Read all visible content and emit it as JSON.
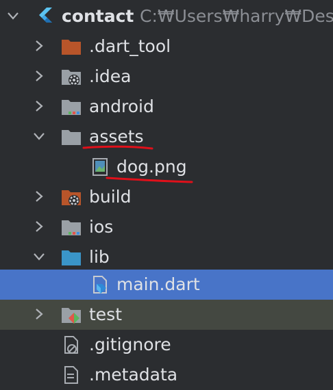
{
  "project": {
    "name": "contact",
    "path": "C:₩Users₩harry₩Desl"
  },
  "tree": {
    "items": [
      {
        "label": ".dart_tool"
      },
      {
        "label": ".idea"
      },
      {
        "label": "android"
      },
      {
        "label": "assets"
      },
      {
        "label": "dog.png"
      },
      {
        "label": "build"
      },
      {
        "label": "ios"
      },
      {
        "label": "lib"
      },
      {
        "label": "main.dart"
      },
      {
        "label": "test"
      },
      {
        "label": ".gitignore"
      },
      {
        "label": ".metadata"
      }
    ]
  },
  "colors": {
    "background": "#2b2d30",
    "selected": "#4874c8",
    "highlight": "#444841",
    "annotation": "#e0101a",
    "flutter_blue": "#3fa9e8",
    "excluded_folder": "#b8552a",
    "folder_grey": "#9aa0a6",
    "source_folder": "#3a95c8"
  },
  "icons": {
    "root": "flutter-icon",
    "dart_tool": "excluded-folder-icon",
    "idea": "settings-folder-icon",
    "android": "module-folder-icon",
    "assets": "folder-icon",
    "dog_png": "image-file-icon",
    "build": "excluded-settings-folder-icon",
    "ios": "module-folder-icon",
    "lib": "source-folder-icon",
    "main_dart": "dart-file-icon",
    "test": "test-folder-icon",
    "gitignore": "ignore-file-icon",
    "metadata": "text-file-icon"
  }
}
